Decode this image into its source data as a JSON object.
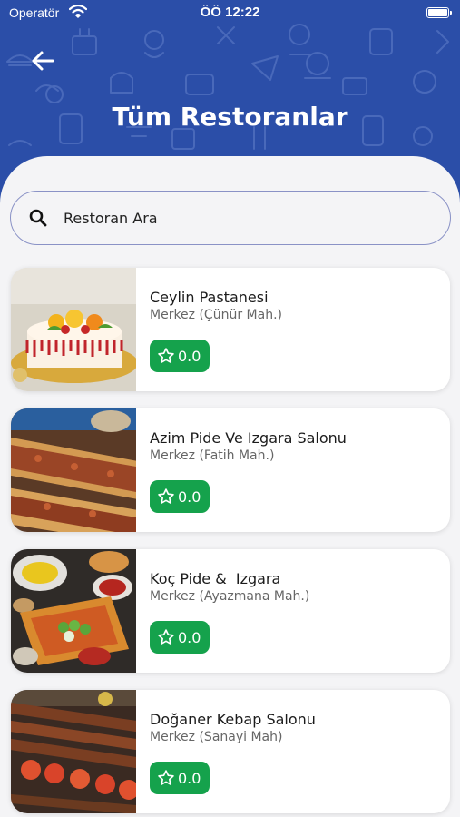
{
  "status_bar": {
    "carrier": "Operatör",
    "time": "ÖÖ 12:22"
  },
  "header": {
    "title": "Tüm Restoranlar"
  },
  "search": {
    "placeholder": "Restoran Ara"
  },
  "restaurants": [
    {
      "name": "Ceylin Pastanesi",
      "address": "Merkez (Çünür Mah.)",
      "rating": "0.0"
    },
    {
      "name": "Azim Pide Ve Izgara Salonu",
      "address": "Merkez (Fatih Mah.)",
      "rating": "0.0"
    },
    {
      "name": "Koç Pide &  Izgara",
      "address": "Merkez (Ayazmana Mah.)",
      "rating": "0.0"
    },
    {
      "name": "Doğaner Kebap Salonu",
      "address": "Merkez (Sanayi Mah)",
      "rating": "0.0"
    }
  ],
  "colors": {
    "header": "#2b4ea8",
    "badge": "#15a24c",
    "background": "#f4f4f6"
  },
  "icons": [
    "wifi-icon",
    "battery-icon",
    "back-arrow-icon",
    "search-icon",
    "star-icon"
  ]
}
